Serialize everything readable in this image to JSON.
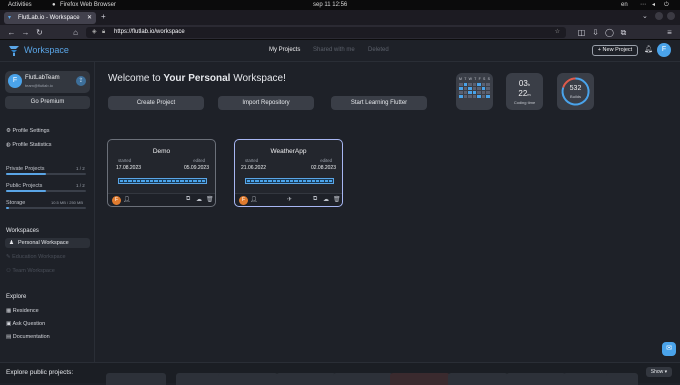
{
  "os": {
    "activities": "Activities",
    "app": "Firefox Web Browser",
    "clock": "sep 11  12:56",
    "lang": "en"
  },
  "browser": {
    "tab_title": "FlutLab.io - Workspace",
    "new_tab": "+",
    "url": "https://flutlab.io/workspace"
  },
  "header": {
    "brand": "Workspace",
    "nav": [
      "My Projects",
      "Shared with me",
      "Deleted"
    ],
    "new_project": "+ New Project",
    "avatar_letter": "F"
  },
  "sidebar": {
    "avatar_letter": "F",
    "user_name": "FlutLabTeam",
    "user_email": "team@flutlab.io",
    "go_premium": "Go Premium",
    "profile_settings": "Profile Settings",
    "profile_statistics": "Profile Statistics",
    "private_projects": "Private Projects",
    "private_count": "1 / 2",
    "private_fill": 0.5,
    "public_projects": "Public Projects",
    "public_count": "1 / 2",
    "public_fill": 0.5,
    "storage": "Storage",
    "storage_value": "10.5 MB / 250 MB",
    "storage_fill": 0.04,
    "workspaces_heading": "Workspaces",
    "personal_workspace": "Personal Workspace",
    "education_workspace": "Education Workspace",
    "team_workspace": "Team Workspace",
    "explore_heading": "Explore",
    "residence": "Residence",
    "ask_question": "Ask Question",
    "documentation": "Documentation"
  },
  "main": {
    "welcome_prefix": "Welcome to ",
    "welcome_bold": "Your Personal",
    "welcome_suffix": " Workspace!",
    "create_project": "Create Project",
    "import_repository": "Import Repository",
    "start_learning": "Start Learning Flutter",
    "calendar_days": [
      "M",
      "T",
      "W",
      "T",
      "F",
      "S",
      "S"
    ],
    "coding_big": "03",
    "coding_unit": "h",
    "coding_big2": "22",
    "coding_unit2": "m",
    "coding_label": "Coding time",
    "builds_value": "532",
    "builds_label": "Builds",
    "explore_public": "Explore public projects:",
    "show_button": "Show"
  },
  "projects": [
    {
      "name": "Demo",
      "started_label": "started",
      "started": "17.08.2023",
      "edited_label": "edited",
      "edited": "05.09.2023",
      "avatar": "F"
    },
    {
      "name": "WeatherApp",
      "started_label": "started",
      "started": "21.06.2022",
      "edited_label": "edited",
      "edited": "02.08.2023",
      "avatar": "F"
    }
  ],
  "colors": {
    "accent": "#4aa3ea",
    "bg": "#1e2128",
    "card": "#23262d",
    "avatar_orange": "#e07b2e"
  }
}
